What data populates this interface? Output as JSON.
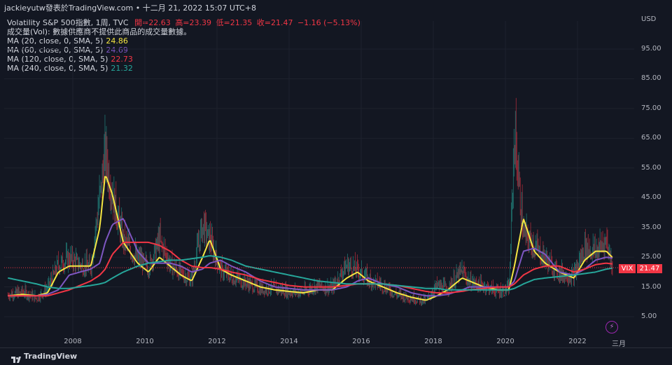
{
  "header": {
    "author": "jackieyutw發表於TradingView.com • 十二月 21, 2022 15:07 UTC+8"
  },
  "legend": {
    "symbol": "Volatility S&P 500指數, 1周, TVC",
    "open_label": "開=",
    "open": "22.63",
    "high_label": "高=",
    "high": "23.39",
    "low_label": "低=",
    "low": "21.35",
    "close_label": "收=",
    "close": "21.47",
    "change": "−1.16 (−5.13%)",
    "volume_note": "成交量(Vol): 數據供應商不提供此商品的成交量數據。",
    "ma": [
      {
        "label": "MA (20, close, 0, SMA, 5)",
        "value": "24.86",
        "color": "#f5e642"
      },
      {
        "label": "MA (60, close, 0, SMA, 5)",
        "value": "24.69",
        "color": "#7e57c2"
      },
      {
        "label": "MA (120, close, 0, SMA, 5)",
        "value": "22.73",
        "color": "#f23645"
      },
      {
        "label": "MA (240, close, 0, SMA, 5)",
        "value": "21.32",
        "color": "#26a69a"
      }
    ]
  },
  "price_tag": {
    "symbol": "VIX",
    "value": "21.47"
  },
  "footer": {
    "brand": "TradingView"
  },
  "chart_data": {
    "type": "line",
    "currency_label": "USD",
    "y_ticks": [
      "95.00",
      "85.00",
      "75.00",
      "65.00",
      "55.00",
      "45.00",
      "35.00",
      "25.00",
      "15.00",
      "5.00"
    ],
    "x_ticks": [
      "2008",
      "2010",
      "2012",
      "2014",
      "2016",
      "2018",
      "2020",
      "2022",
      "三月"
    ],
    "ylim": [
      0,
      100
    ],
    "colors": {
      "up": "#26a69a",
      "down": "#f23645",
      "ma20": "#f5e642",
      "ma60": "#7e57c2",
      "ma120": "#f23645",
      "ma240": "#26a69a"
    },
    "x": [
      2006.2,
      2006.6,
      2007.0,
      2007.3,
      2007.6,
      2007.9,
      2008.2,
      2008.5,
      2008.75,
      2008.9,
      2009.1,
      2009.4,
      2009.8,
      2010.1,
      2010.4,
      2010.7,
      2011.0,
      2011.3,
      2011.6,
      2011.8,
      2012.1,
      2012.4,
      2012.8,
      2013.2,
      2013.6,
      2014.0,
      2014.4,
      2014.8,
      2015.2,
      2015.6,
      2015.9,
      2016.2,
      2016.6,
      2017.0,
      2017.4,
      2017.8,
      2018.1,
      2018.4,
      2018.8,
      2019.0,
      2019.4,
      2019.8,
      2020.1,
      2020.25,
      2020.5,
      2020.8,
      2021.1,
      2021.5,
      2021.9,
      2022.2,
      2022.5,
      2022.8,
      2022.97
    ],
    "series": [
      {
        "name": "Volatility S&P 500指數",
        "values": [
          12,
          13,
          11,
          14,
          22,
          24,
          22,
          21,
          45,
          58,
          45,
          30,
          24,
          21,
          30,
          22,
          19,
          17,
          35,
          30,
          20,
          18,
          16,
          14,
          14,
          13,
          13,
          15,
          14,
          22,
          20,
          17,
          15,
          12,
          11,
          10,
          15,
          14,
          20,
          16,
          15,
          13,
          14,
          65,
          32,
          28,
          24,
          19,
          18,
          28,
          26,
          30,
          21.47
        ]
      },
      {
        "name": "MA (20, close, 0, SMA, 5)",
        "values": [
          12,
          12.5,
          12,
          13,
          20,
          22,
          22,
          22,
          35,
          53,
          46,
          30,
          23,
          20,
          25,
          22,
          19,
          17,
          25,
          31,
          21,
          19,
          17,
          15,
          14,
          13.5,
          13,
          14,
          14,
          18,
          20,
          17,
          15,
          13,
          11.5,
          10.5,
          12,
          14,
          18,
          17,
          15,
          14,
          14,
          22,
          38,
          27,
          23,
          20,
          18,
          24,
          27,
          27,
          24.86
        ]
      },
      {
        "name": "MA (60, close, 0, SMA, 5)",
        "values": [
          12,
          12,
          12,
          12.5,
          14,
          19,
          20,
          21,
          23,
          30,
          36,
          38,
          27,
          23,
          23,
          23,
          22,
          20,
          21,
          23,
          24,
          22,
          20,
          17,
          15,
          14.5,
          14,
          14,
          14,
          15,
          17,
          18,
          16,
          15,
          13,
          12,
          12,
          12.5,
          14,
          15,
          15,
          15,
          15,
          17,
          27,
          28,
          26,
          20,
          19,
          21,
          24,
          25,
          24.69
        ]
      },
      {
        "name": "MA (120, close, 0, SMA, 5)",
        "values": [
          12,
          12,
          12,
          12,
          13,
          14,
          15.5,
          17,
          19,
          21,
          26,
          30,
          30,
          30,
          29,
          27,
          24,
          22,
          21.5,
          21.5,
          21,
          20,
          19,
          17.5,
          16.5,
          15.5,
          15,
          15,
          15,
          15.5,
          16,
          16,
          16,
          15.5,
          14.5,
          13.5,
          13,
          13,
          13.5,
          14,
          14.5,
          15,
          15,
          16,
          19,
          21,
          22,
          22,
          20,
          21,
          22.5,
          23,
          22.73
        ]
      },
      {
        "name": "MA (240, close, 0, SMA, 5)",
        "values": [
          18,
          17,
          16,
          15,
          14.5,
          14.5,
          15,
          15.5,
          16,
          16.5,
          18,
          20,
          22,
          23,
          23.5,
          24,
          24,
          24.5,
          25,
          25.5,
          25,
          24,
          22,
          21,
          20,
          19,
          18,
          17,
          16.5,
          16,
          16,
          16,
          16,
          15.5,
          15,
          14.5,
          14.5,
          14,
          14,
          14,
          14,
          14,
          14,
          14.5,
          16,
          17.5,
          18,
          18.5,
          19,
          19.5,
          20,
          21,
          21.32
        ]
      }
    ]
  }
}
